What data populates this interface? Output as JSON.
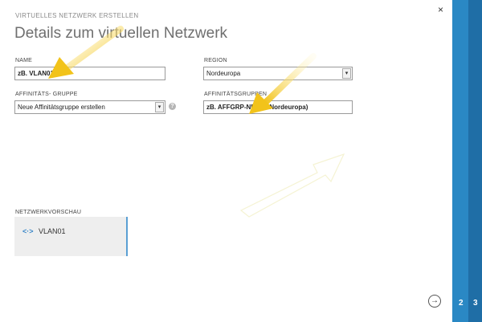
{
  "header": {
    "subtitle": "VIRTUELLES NETZWERK ERSTELLEN",
    "title": "Details zum virtuellen Netzwerk",
    "close_glyph": "×"
  },
  "form": {
    "name": {
      "label": "NAME",
      "value": "zB. VLAN01"
    },
    "region": {
      "label": "REGION",
      "value": "Nordeuropa"
    },
    "affinity_group": {
      "label": "AFFINITÄTS- GRUPPE",
      "value": "Neue Affinitätsgruppe erstellen",
      "help": "?"
    },
    "affinity_group_name": {
      "label": "AFFINITÄTSGRUPPEN",
      "value": "zB. AFFGRP-NE (für Nordeuropa)"
    }
  },
  "preview": {
    "label": "NETZWERKVORSCHAU",
    "icon": "<·>",
    "network_name": "VLAN01"
  },
  "footer": {
    "next_glyph": "→"
  },
  "steps": {
    "step2": "2",
    "step3": "3"
  },
  "colors": {
    "accent": "#2a88c4",
    "accent_dark": "#1f6ea6",
    "arrow": "#f2c31a"
  }
}
